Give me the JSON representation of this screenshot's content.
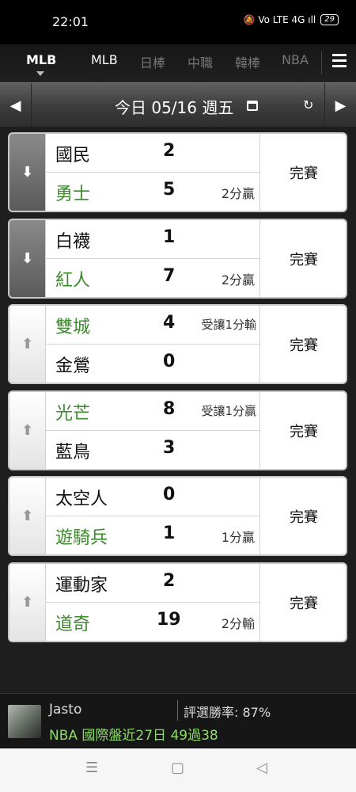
{
  "status_bar": {
    "time": "22:01",
    "icons": "🔕 Vo LTE 4G ıll",
    "battery": "29"
  },
  "leagues": {
    "current": "MLB",
    "tabs": [
      "MLB",
      "日棒",
      "中職",
      "韓棒",
      "NBA"
    ]
  },
  "date_bar": {
    "date_text": "今日 05/16 週五"
  },
  "games": [
    {
      "arrow": "down",
      "top": {
        "name": "國民",
        "score": "2",
        "note": "",
        "green": false
      },
      "bottom": {
        "name": "勇士",
        "score": "5",
        "note": "2分贏",
        "green": true
      },
      "status": "完賽"
    },
    {
      "arrow": "down",
      "top": {
        "name": "白襪",
        "score": "1",
        "note": "",
        "green": false
      },
      "bottom": {
        "name": "紅人",
        "score": "7",
        "note": "2分贏",
        "green": true
      },
      "status": "完賽"
    },
    {
      "arrow": "up",
      "top": {
        "name": "雙城",
        "score": "4",
        "note": "受讓1分輸",
        "green": true
      },
      "bottom": {
        "name": "金鶯",
        "score": "0",
        "note": "",
        "green": false
      },
      "status": "完賽"
    },
    {
      "arrow": "up",
      "top": {
        "name": "光芒",
        "score": "8",
        "note": "受讓1分贏",
        "green": true
      },
      "bottom": {
        "name": "藍鳥",
        "score": "3",
        "note": "",
        "green": false
      },
      "status": "完賽"
    },
    {
      "arrow": "up",
      "top": {
        "name": "太空人",
        "score": "0",
        "note": "",
        "green": false
      },
      "bottom": {
        "name": "遊騎兵",
        "score": "1",
        "note": "1分贏",
        "green": true
      },
      "status": "完賽"
    },
    {
      "arrow": "up",
      "top": {
        "name": "運動家",
        "score": "2",
        "note": "",
        "green": false
      },
      "bottom": {
        "name": "道奇",
        "score": "19",
        "note": "2分輸",
        "green": true
      },
      "status": "完賽"
    }
  ],
  "footer_ad": {
    "name": "Jasto",
    "rate": "評選勝率: 87%",
    "line": "NBA 國際盤近27日 49過38"
  },
  "colors": {
    "green": "#3b8a2c",
    "ad_green": "#8edb6a"
  }
}
